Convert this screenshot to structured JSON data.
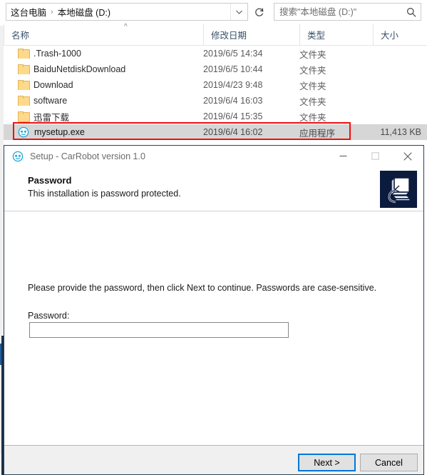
{
  "explorer": {
    "address": {
      "crumbs": [
        "这台电脑",
        "本地磁盘 (D:)"
      ],
      "separator": "›",
      "dropdown_icon": "chevron-down-icon",
      "refresh_icon": "refresh-icon"
    },
    "search": {
      "placeholder": "搜索\"本地磁盘 (D:)\"",
      "value": "",
      "icon": "search-icon"
    },
    "columns": [
      {
        "label": "名称",
        "sort_indicator": "^"
      },
      {
        "label": "修改日期"
      },
      {
        "label": "类型"
      },
      {
        "label": "大小"
      }
    ],
    "files": [
      {
        "name": ".Trash-1000",
        "date": "2019/6/5 14:34",
        "type": "文件夹",
        "size": "",
        "icon": "folder-icon",
        "selected": false
      },
      {
        "name": "BaiduNetdiskDownload",
        "date": "2019/6/5 10:44",
        "type": "文件夹",
        "size": "",
        "icon": "folder-icon",
        "selected": false
      },
      {
        "name": "Download",
        "date": "2019/4/23 9:48",
        "type": "文件夹",
        "size": "",
        "icon": "folder-icon",
        "selected": false
      },
      {
        "name": "software",
        "date": "2019/6/4 16:03",
        "type": "文件夹",
        "size": "",
        "icon": "folder-icon",
        "selected": false
      },
      {
        "name": "迅雷下载",
        "date": "2019/6/4 15:35",
        "type": "文件夹",
        "size": "",
        "icon": "folder-icon",
        "selected": false
      },
      {
        "name": "mysetup.exe",
        "date": "2019/6/4 16:02",
        "type": "应用程序",
        "size": "11,413 KB",
        "icon": "exe-icon",
        "selected": true
      }
    ],
    "annotation": {
      "color": "#ee1111",
      "target": "mysetup.exe"
    }
  },
  "dialog": {
    "title": "Setup - CarRobot version 1.0",
    "title_icon": "carrobot-app-icon",
    "window_buttons": [
      {
        "name": "minimize",
        "glyph": "minimize-icon"
      },
      {
        "name": "maximize",
        "glyph": "maximize-icon"
      },
      {
        "name": "close",
        "glyph": "close-icon"
      }
    ],
    "header": {
      "title": "Password",
      "subtitle": "This installation is password protected.",
      "icon": "computer-install-icon",
      "icon_bg": "#0b1b3d"
    },
    "body": {
      "instruction": "Please provide the password, then click Next to continue. Passwords are case-sensitive.",
      "password_label": "Password:",
      "password_value": "",
      "password_placeholder": ""
    },
    "footer": {
      "next_label": "Next >",
      "cancel_label": "Cancel",
      "focus_color": "#0078d7"
    }
  }
}
